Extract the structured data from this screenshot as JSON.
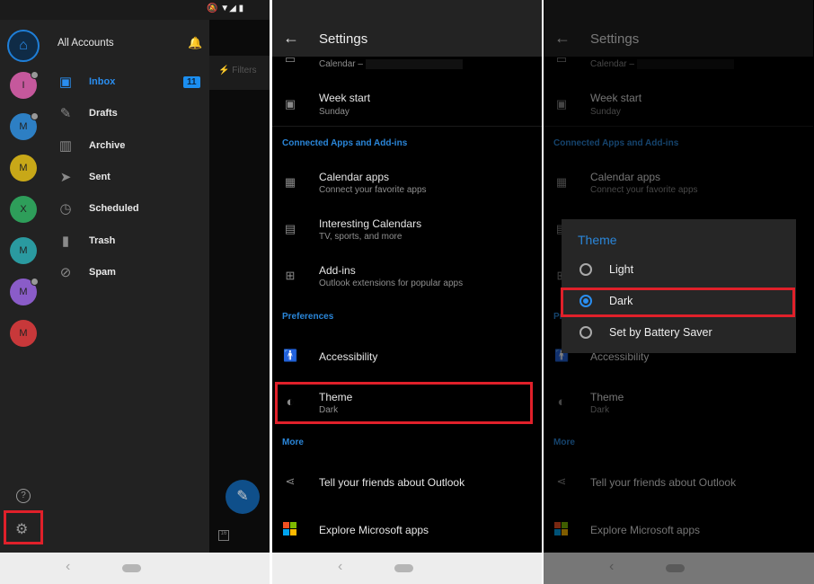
{
  "colors": {
    "accent": "#2a86d9",
    "highlight": "#e0202a",
    "drawer_bg": "#222222"
  },
  "drawer": {
    "title": "All Accounts",
    "accounts": [
      {
        "initial": "I",
        "color": "#c5589c",
        "dot": true
      },
      {
        "initial": "M",
        "color": "#2d7fc4",
        "dot": true
      },
      {
        "initial": "M",
        "color": "#c8a818",
        "dot": false
      },
      {
        "initial": "X",
        "color": "#2e9e5a",
        "dot": false
      },
      {
        "initial": "M",
        "color": "#2a9aa0",
        "dot": false
      },
      {
        "initial": "M",
        "color": "#8a5cc8",
        "dot": true
      },
      {
        "initial": "M",
        "color": "#c8383a",
        "dot": false
      }
    ],
    "folders": [
      {
        "label": "Inbox",
        "icon": "inbox-icon",
        "badge": "11",
        "active": true
      },
      {
        "label": "Drafts",
        "icon": "drafts-icon"
      },
      {
        "label": "Archive",
        "icon": "archive-icon"
      },
      {
        "label": "Sent",
        "icon": "send-icon"
      },
      {
        "label": "Scheduled",
        "icon": "clock-icon"
      },
      {
        "label": "Trash",
        "icon": "trash-icon"
      },
      {
        "label": "Spam",
        "icon": "spam-icon"
      }
    ],
    "behind_filters": "Filters"
  },
  "settings": {
    "title": "Settings",
    "calendar_partial": "Calendar –",
    "week_start": {
      "title": "Week start",
      "sub": "Sunday"
    },
    "sec_connected": "Connected Apps and Add-ins",
    "calendar_apps": {
      "title": "Calendar apps",
      "sub": "Connect your favorite apps"
    },
    "interesting": {
      "title": "Interesting Calendars",
      "sub": "TV, sports, and more"
    },
    "addins": {
      "title": "Add-ins",
      "sub": "Outlook extensions for popular apps"
    },
    "sec_prefs": "Preferences",
    "accessibility": "Accessibility",
    "theme": {
      "title": "Theme",
      "sub": "Dark"
    },
    "sec_more": "More",
    "tell": "Tell your friends about Outlook",
    "explore": "Explore Microsoft apps"
  },
  "theme_dialog": {
    "title": "Theme",
    "options": [
      {
        "label": "Light",
        "selected": false
      },
      {
        "label": "Dark",
        "selected": true
      },
      {
        "label": "Set by Battery Saver",
        "selected": false
      }
    ]
  }
}
